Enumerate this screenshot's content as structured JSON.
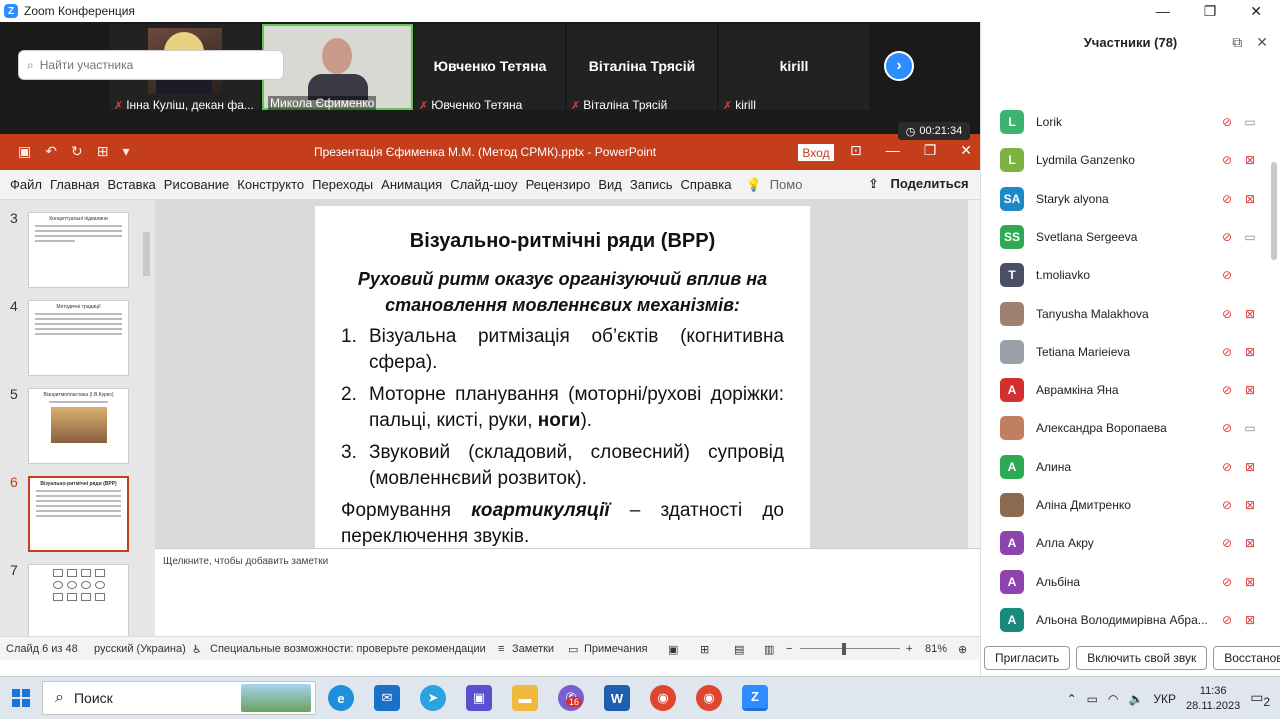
{
  "window": {
    "title": "Zoom Конференция",
    "min": "—",
    "max": "❐",
    "close": "✕"
  },
  "video_tiles": [
    {
      "name": "Інна Куліш, декан фа...",
      "big": ""
    },
    {
      "name": "Микола Єфименко",
      "big": ""
    },
    {
      "name": "Ювченко Тетяна",
      "big": "Ювченко Тетяна"
    },
    {
      "name": "Віталіна Трясій",
      "big": "Віталіна Трясій"
    },
    {
      "name": "kirill",
      "big": "kirill"
    }
  ],
  "timer": "00:21:34",
  "powerpoint": {
    "doc_title": "Презентація Єфименка М.М. (Метод СРМК).pptx  -  PowerPoint",
    "login": "Вход",
    "tabs": [
      "Файл",
      "Главная",
      "Вставка",
      "Рисование",
      "Конструкто",
      "Переходы",
      "Анимация",
      "Слайд-шоу",
      "Рецензиро",
      "Вид",
      "Запись",
      "Справка",
      "Помо"
    ],
    "share": "Поделиться",
    "thumbs": [
      {
        "num": "3",
        "title": "Концептуальні підвалини"
      },
      {
        "num": "4",
        "title": "Методичні традиції"
      },
      {
        "num": "5",
        "title": "Візоритмопластика (І.В.Курко)"
      },
      {
        "num": "6",
        "title": "Візуально-ритмічні ряди (ВРР)"
      },
      {
        "num": "7",
        "title": ""
      }
    ],
    "slide": {
      "title": "Візуально-ритмічні ряди (ВРР)",
      "subtitle": "Руховий ритм оказує організуючий вплив на становлення мовленнєвих механізмів:",
      "items": [
        {
          "n": "1.",
          "text": "Візуальна ритмізація об’єктів (когнитивна сфера)."
        },
        {
          "n": "2.",
          "text_a": "Моторне планування (моторні/рухові доріжки: пальці, кисті, руки, ",
          "bold": "ноги",
          "text_b": ")."
        },
        {
          "n": "3.",
          "text": "Звуковий (складовий, словесний) супровід (мовленнєвий розвиток)."
        }
      ],
      "form_a": "Формування ",
      "form_b": "коартикуляції",
      "form_c": " – здатності до переключення звуків."
    },
    "notes_placeholder": "Щелкните, чтобы добавить заметки",
    "status": {
      "slide": "Слайд 6 из 48",
      "lang": "русский (Украина)",
      "access": "Специальные возможности: проверьте рекомендации",
      "notes": "Заметки",
      "comments": "Примечания",
      "zoom": "81%"
    }
  },
  "participants": {
    "header": "Участники (78)",
    "search_placeholder": "Найти участника",
    "list": [
      {
        "initials": "L",
        "name": "Lorik",
        "color": "#3cb371",
        "cam_off": false,
        "mic_off": true
      },
      {
        "initials": "L",
        "name": "Lydmila Ganzenko",
        "color": "#7cb342",
        "cam_off": true,
        "mic_off": true
      },
      {
        "initials": "SA",
        "name": "Staryk alyona",
        "color": "#1e88c8",
        "cam_off": true,
        "mic_off": true
      },
      {
        "initials": "SS",
        "name": "Svetlana Sergeeva",
        "color": "#2eaa55",
        "cam_off": false,
        "mic_off": true
      },
      {
        "initials": "T",
        "name": "t.moliavko",
        "color": "#4a4f63",
        "cam_off": null,
        "mic_off": true
      },
      {
        "initials": "",
        "name": "Tanyusha Malakhova",
        "color": "#a08070",
        "cam_off": true,
        "mic_off": true
      },
      {
        "initials": "",
        "name": "Tetiana Marieieva",
        "color": "#9aa0a8",
        "cam_off": true,
        "mic_off": true
      },
      {
        "initials": "А",
        "name": "Аврамкіна Яна",
        "color": "#d32f2f",
        "cam_off": true,
        "mic_off": true
      },
      {
        "initials": "",
        "name": "Александра Воропаева",
        "color": "#c08060",
        "cam_off": false,
        "mic_off": true
      },
      {
        "initials": "А",
        "name": "Алина",
        "color": "#2eaa55",
        "cam_off": true,
        "mic_off": true
      },
      {
        "initials": "",
        "name": "Аліна Дмитренко",
        "color": "#8b6a50",
        "cam_off": true,
        "mic_off": true
      },
      {
        "initials": "А",
        "name": "Алла Акру",
        "color": "#8e44ad",
        "cam_off": true,
        "mic_off": true
      },
      {
        "initials": "А",
        "name": "Альбіна",
        "color": "#8e44ad",
        "cam_off": true,
        "mic_off": true
      },
      {
        "initials": "А",
        "name": "Альона Володимирівна Абра...",
        "color": "#1a8a7a",
        "cam_off": true,
        "mic_off": true
      }
    ],
    "buttons": [
      "Пригласить",
      "Включить свой звук",
      "Восстановить"
    ]
  },
  "taskbar": {
    "search": "Поиск",
    "badge": "16",
    "lang": "УКР",
    "time": "11:36",
    "date": "28.11.2023",
    "notif": "2"
  }
}
